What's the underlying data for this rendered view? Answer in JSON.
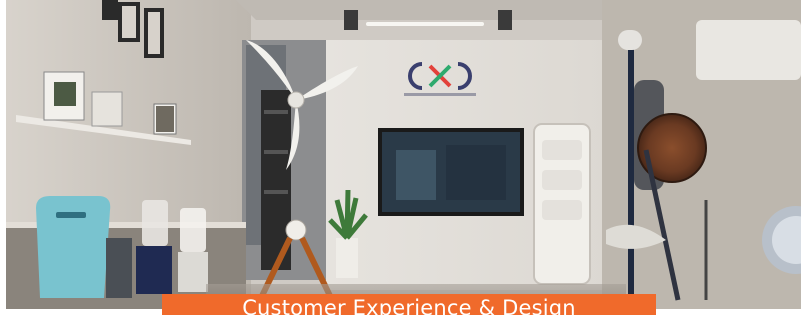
{
  "banner": {
    "caption": "Customer Experience & Design",
    "logo_text": "CXD",
    "logo_tagline": "CUSTOMER EXPERIENCE & DESIGN",
    "caption_bg_color": "#f06a2b"
  }
}
